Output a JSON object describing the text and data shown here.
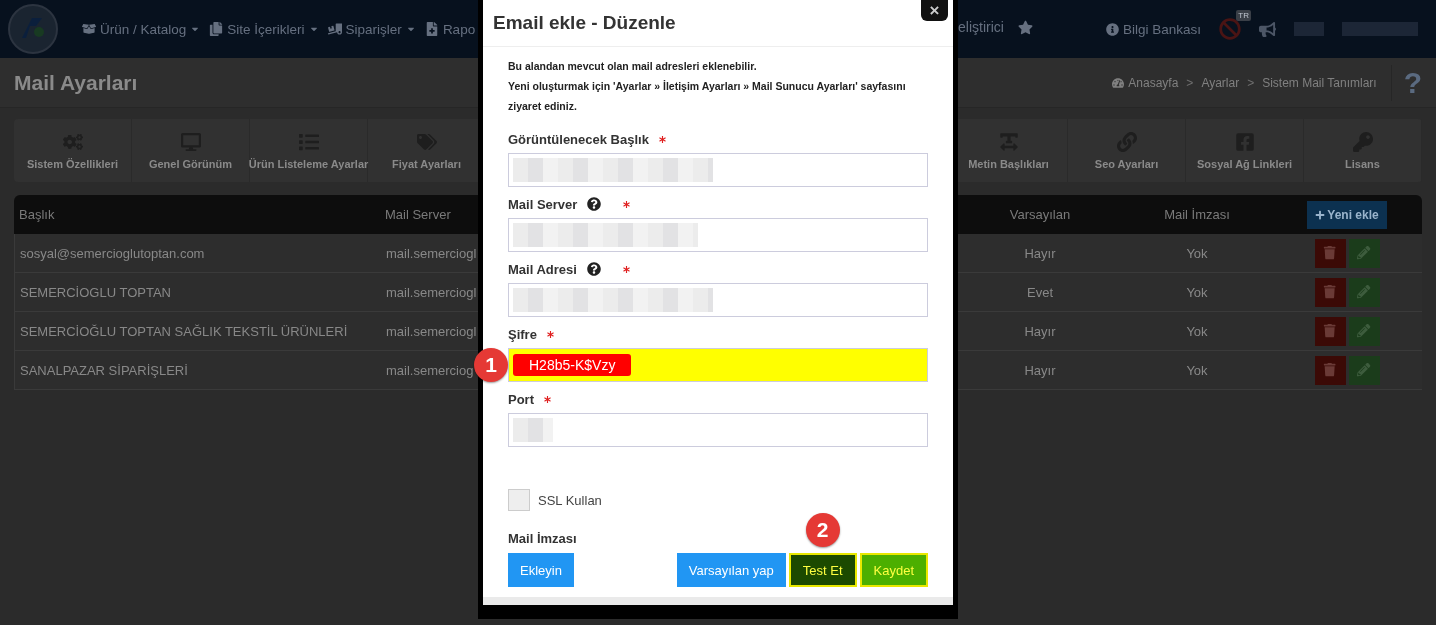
{
  "header": {
    "nav": [
      {
        "label": "Ürün / Katalog",
        "dropdown": true
      },
      {
        "label": "Site İçerikleri",
        "dropdown": true
      },
      {
        "label": "Siparişler",
        "dropdown": true
      },
      {
        "label": "Rapo",
        "dropdown": false
      }
    ],
    "nav_right_cut": "eliştirici",
    "help_link": "Bilgi Bankası",
    "language_badge": "TR",
    "user_redacted": true
  },
  "page": {
    "title": "Mail Ayarları",
    "breadcrumb": [
      "Anasayfa",
      "Ayarlar",
      "Sistem Mail Tanımları"
    ],
    "breadcrumb_separator": ">",
    "help_mark": "?"
  },
  "tiles_left": [
    {
      "label": "Sistem Özellikleri",
      "kind": "cogs"
    },
    {
      "label": "Genel Görünüm",
      "kind": "desktop"
    },
    {
      "label": "Ürün Listeleme Ayarlar",
      "kind": "list"
    },
    {
      "label": "Fiyat Ayarları",
      "kind": "tags"
    }
  ],
  "tiles_right": [
    {
      "label": "Metin Başlıkları",
      "kind": "text"
    },
    {
      "label": "Seo Ayarları",
      "kind": "link"
    },
    {
      "label": "Sosyal Ağ Linkleri",
      "kind": "facebook"
    },
    {
      "label": "Lisans",
      "kind": "key"
    }
  ],
  "table": {
    "columns_left": [
      "Başlık",
      "Mail Server"
    ],
    "columns_right": [
      "Varsayılan",
      "Mail İmzası"
    ],
    "add_button": "Yeni ekle",
    "rows": [
      {
        "title": "sosyal@semercioglutoptan.com",
        "server": "mail.semerciogl",
        "default": "Hayır",
        "signature": "Yok"
      },
      {
        "title": "SEMERCİOGLU TOPTAN",
        "server": "mail.semerciogl",
        "default": "Evet",
        "signature": "Yok"
      },
      {
        "title": "SEMERCİOĞLU TOPTAN SAĞLIK TEKSTİL ÜRÜNLERİ",
        "server": "mail.semerciogl",
        "default": "Hayır",
        "signature": "Yok"
      },
      {
        "title": "SANALPAZAR SİPARİŞLERİ",
        "server": "mail.semerciog",
        "default": "Hayır",
        "signature": "Yok"
      }
    ]
  },
  "modal": {
    "title": "Email ekle - Düzenle",
    "close": "×",
    "intro": [
      "Bu alandan mevcut olan mail adresleri eklenebilir.",
      "Yeni oluşturmak için 'Ayarlar » İletişim Ayarları » Mail Sunucu Ayarları' sayfasını ziyaret ediniz."
    ],
    "fields": [
      {
        "label": "Görüntülenecek Başlık",
        "required": true,
        "help": false,
        "redacted": true,
        "highlighted": false
      },
      {
        "label": "Mail Server",
        "required": true,
        "help": true,
        "redacted": true,
        "highlighted": false
      },
      {
        "label": "Mail Adresi",
        "required": true,
        "help": true,
        "redacted": true,
        "highlighted": false
      },
      {
        "label": "Şifre",
        "required": true,
        "help": false,
        "redacted": false,
        "highlighted": true,
        "value": "H28b5-K$Vzy",
        "annotation": "1"
      },
      {
        "label": "Port",
        "required": true,
        "help": false,
        "redacted": true,
        "highlighted": false
      }
    ],
    "ssl": {
      "label": "SSL Kullan",
      "checked": false
    },
    "signature": {
      "label": "Mail İmzası",
      "button": "Ekleyin"
    },
    "buttons": [
      {
        "label": "Varsayılan yap",
        "kind": "primary"
      },
      {
        "label": "Test Et",
        "kind": "test",
        "annotation": "2"
      },
      {
        "label": "Kaydet",
        "kind": "save"
      }
    ]
  }
}
